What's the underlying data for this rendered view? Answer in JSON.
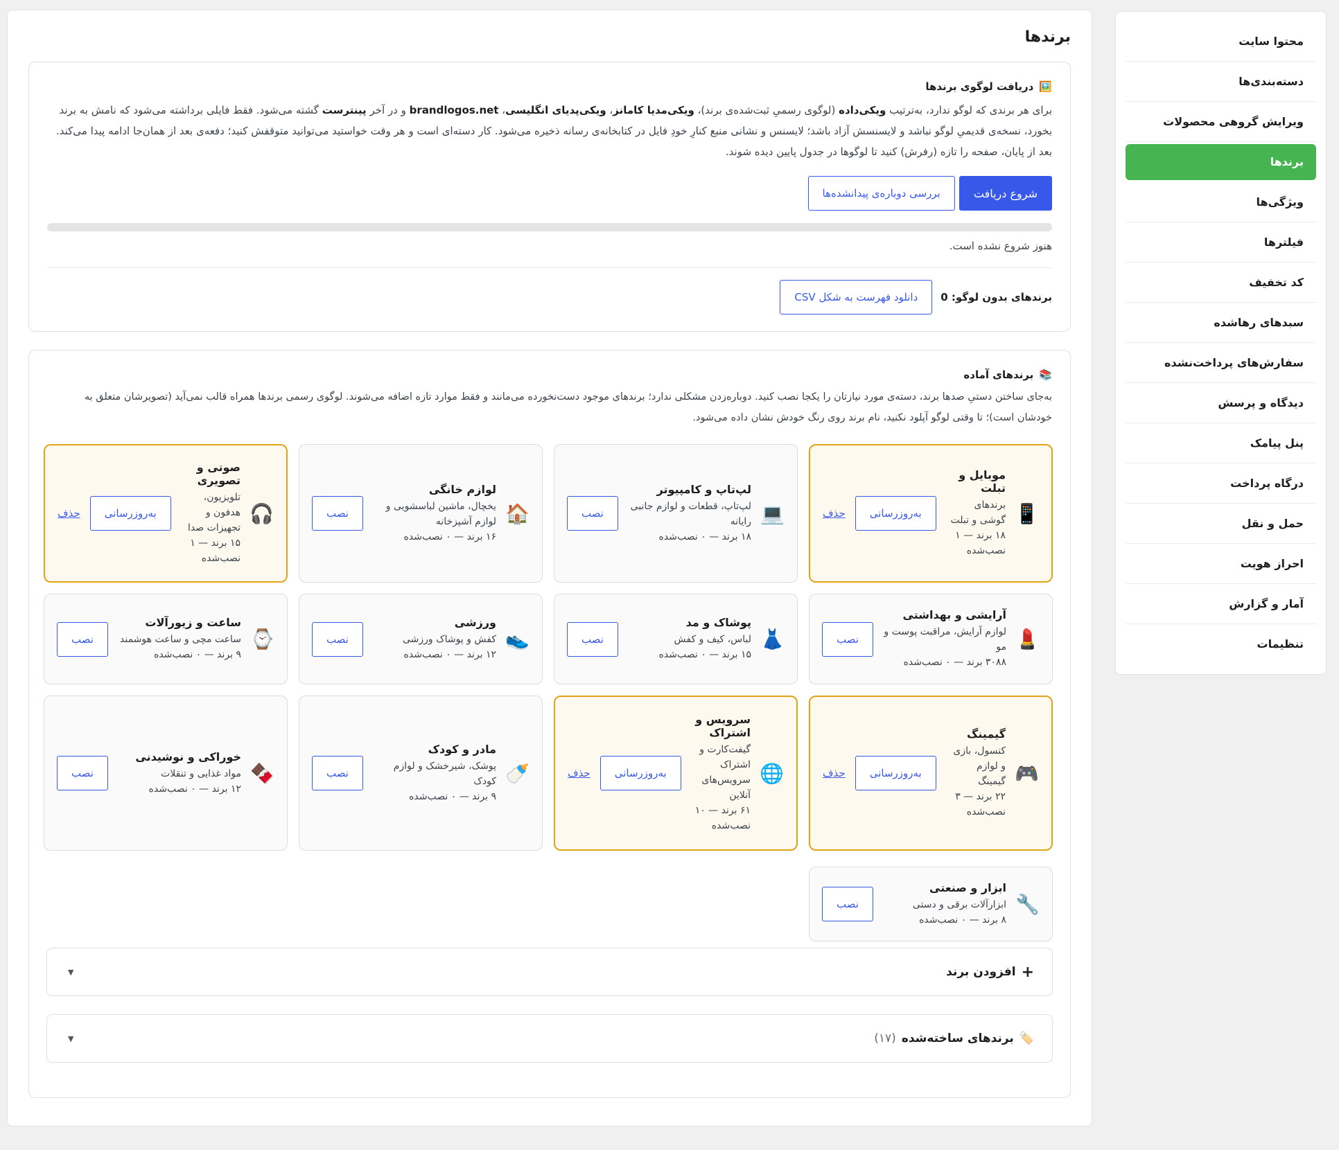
{
  "sidebar": {
    "items": [
      {
        "label": "محتوا سایت"
      },
      {
        "label": "دسته‌بندی‌ها"
      },
      {
        "label": "ویرایش گروهی محصولات"
      },
      {
        "label": "برندها"
      },
      {
        "label": "ویژگی‌ها"
      },
      {
        "label": "فیلترها"
      },
      {
        "label": "کد تخفیف"
      },
      {
        "label": "سبدهای رهاشده"
      },
      {
        "label": "سفارش‌های پرداخت‌نشده"
      },
      {
        "label": "دیدگاه و پرسش"
      },
      {
        "label": "پنل پیامک"
      },
      {
        "label": "درگاه پرداخت"
      },
      {
        "label": "حمل و نقل"
      },
      {
        "label": "احراز هویت"
      },
      {
        "label": "آمار و گزارش"
      },
      {
        "label": "تنظیمات"
      }
    ],
    "active": "برندها"
  },
  "page": {
    "title": "برندها"
  },
  "logos": {
    "icon": "🖼️",
    "title": "دریافت لوگوی برندها",
    "p1": "برای هر برندی که لوگو ندارد، به‌ترتیب ",
    "b1": "ویکی‌داده",
    "p2": " (لوگوی رسمیِ ثبت‌شده‌ی برند)، ",
    "b2": "ویکی‌مدیا کامانز",
    "p3": "، ",
    "b3": "ویکی‌پدیای انگلیسی",
    "p4": "، ",
    "b4": "brandlogos.net",
    "p5": " و در آخر ",
    "b5": "پینترست",
    "p6": " گشته می‌شود. فقط فایلی برداشته می‌شود که نامش به برند بخورد، نسخه‌ی قدیمیِ لوگو نباشد و لایسنسش آزاد باشد؛ لایسنس و نشانی منبع کنارِ خودِ فایل در کتابخانه‌ی رسانه ذخیره می‌شود. کار دسته‌ای است و هر وقت خواستید می‌توانید متوقفش کنید؛ دفعه‌ی بعد از همان‌جا ادامه پیدا می‌کند. بعد از پایان، صفحه را تازه (رفرش) کنید تا لوگوها در جدول پایین دیده شوند.",
    "start_label": "شروع دریافت",
    "recheck_label": "بررسی دوباره‌ی پیدانشده‌ها",
    "progress": 0,
    "status": "هنوز شروع نشده است.",
    "nologo_label": "برندهای بدون لوگو:",
    "nologo_count": "0",
    "csv_label": "دانلود فهرست به شکل CSV"
  },
  "ready": {
    "icon": "📚",
    "title": "برندهای آماده",
    "desc": "به‌جای ساختن دستیِ صدها برند، دسته‌ی مورد نیازتان را یکجا نصب کنید. دوباره‌زدن مشکلی ندارد؛ برندهای موجود دست‌نخورده می‌مانند و فقط موارد تازه اضافه می‌شوند. لوگوی رسمی برندها همراه قالب نمی‌آید (تصویرشان متعلق به خودشان است)؛ تا وقتی لوگو آپلود نکنید، نام برند روی رنگ خودش نشان داده می‌شود.",
    "install_label": "نصب",
    "update_label": "به‌روزرسانی",
    "delete_label": "حذف",
    "packs": [
      {
        "icon": "📱",
        "icon_name": "mobile-phone-icon",
        "name": "موبایل و تبلت",
        "desc": "برندهای گوشی و تبلت",
        "count": "۱۸ برند — ۱ نصب‌شده",
        "installed": true
      },
      {
        "icon": "💻",
        "icon_name": "laptop-icon",
        "name": "لپ‌تاپ و کامپیوتر",
        "desc": "لپ‌تاپ، قطعات و لوازم جانبی رایانه",
        "count": "۱۸ برند — ۰ نصب‌شده",
        "installed": false
      },
      {
        "icon": "🏠",
        "icon_name": "house-icon",
        "name": "لوازم خانگی",
        "desc": "یخچال، ماشین لباسشویی و لوازم آشپزخانه",
        "count": "۱۶ برند — ۰ نصب‌شده",
        "installed": false
      },
      {
        "icon": "🎧",
        "icon_name": "headphones-icon",
        "name": "صوتی و تصویری",
        "desc": "تلویزیون، هدفون و تجهیزات صدا",
        "count": "۱۵ برند — ۱ نصب‌شده",
        "installed": true
      },
      {
        "icon": "💄",
        "icon_name": "lipstick-icon",
        "name": "آرایشی و بهداشتی",
        "desc": "لوازم آرایش، مراقبت پوست و مو",
        "count": "۳۰۸۸ برند — ۰ نصب‌شده",
        "installed": false
      },
      {
        "icon": "👗",
        "icon_name": "dress-icon",
        "name": "پوشاک و مد",
        "desc": "لباس، کیف و کفش",
        "count": "۱۵ برند — ۰ نصب‌شده",
        "installed": false
      },
      {
        "icon": "👟",
        "icon_name": "sneaker-icon",
        "name": "ورزشی",
        "desc": "کفش و پوشاک ورزشی",
        "count": "۱۲ برند — ۰ نصب‌شده",
        "installed": false
      },
      {
        "icon": "⌚",
        "icon_name": "watch-icon",
        "name": "ساعت و زیورآلات",
        "desc": "ساعت مچی و ساعت هوشمند",
        "count": "۹ برند — ۰ نصب‌شده",
        "installed": false
      },
      {
        "icon": "🎮",
        "icon_name": "gamepad-icon",
        "name": "گیمینگ",
        "desc": "کنسول، بازی و لوازم گیمینگ",
        "count": "۲۲ برند — ۳ نصب‌شده",
        "installed": true
      },
      {
        "icon": "🌐",
        "icon_name": "globe-icon",
        "name": "سرویس و اشتراک",
        "desc": "گیفت‌کارت و اشتراک سرویس‌های آنلاین",
        "count": "۶۱ برند — ۱۰ نصب‌شده",
        "installed": true
      },
      {
        "icon": "🍼",
        "icon_name": "baby-bottle-icon",
        "name": "مادر و کودک",
        "desc": "پوشک، شیرخشک و لوازم کودک",
        "count": "۹ برند — ۰ نصب‌شده",
        "installed": false
      },
      {
        "icon": "🍫",
        "icon_name": "chocolate-icon",
        "name": "خوراکی و نوشیدنی",
        "desc": "مواد غذایی و تنقلات",
        "count": "۱۲ برند — ۰ نصب‌شده",
        "installed": false
      },
      {
        "icon": "🔧",
        "icon_name": "wrench-icon",
        "name": "ابزار و صنعتی",
        "desc": "ابزارآلات برقی و دستی",
        "count": "۸ برند — ۰ نصب‌شده",
        "installed": false
      }
    ]
  },
  "add_brand": {
    "icon": "+",
    "label": "افزودن برند"
  },
  "built": {
    "icon": "🏷️",
    "label": "برندهای ساخته‌شده",
    "count": "(۱۷)"
  }
}
